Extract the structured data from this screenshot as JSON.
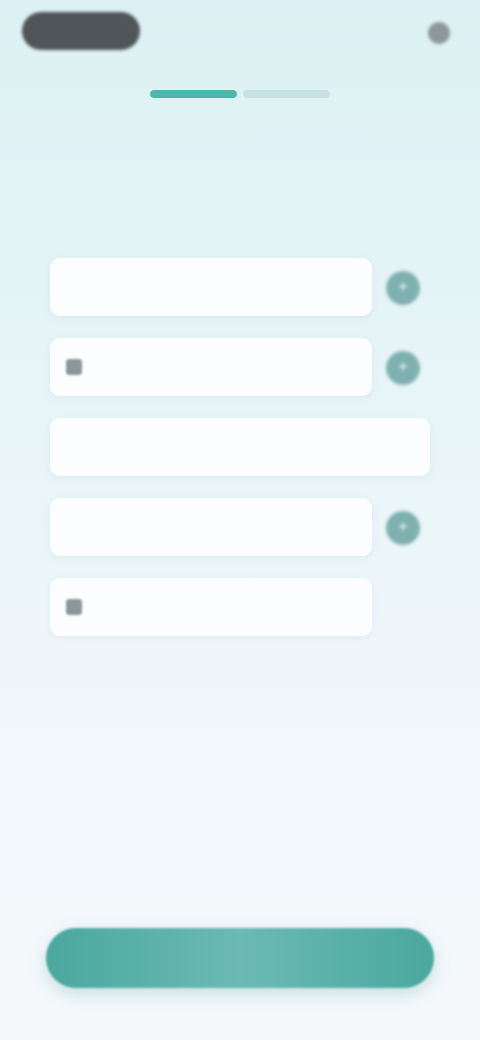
{
  "header": {
    "back_label": "",
    "right_label": ""
  },
  "progress": {
    "current_step": 1,
    "total_steps": 2
  },
  "page": {
    "title": "",
    "subtitle": ""
  },
  "form": {
    "fields": [
      {
        "label": "",
        "icon": "none",
        "has_action": true,
        "action_icon": "add-icon"
      },
      {
        "label": "",
        "icon": "flag-icon",
        "has_action": true,
        "action_icon": "add-icon"
      },
      {
        "label": "",
        "icon": "none",
        "has_action": false
      },
      {
        "label": "",
        "icon": "none",
        "has_action": true,
        "action_icon": "add-icon"
      },
      {
        "label": "",
        "icon": "flag-icon",
        "has_action": false
      }
    ]
  },
  "footer": {
    "link_text": "",
    "cta_label": ""
  },
  "colors": {
    "accent": "#4fb6aa",
    "cta": "#4aa89f",
    "background_top": "#dcf1f3",
    "background_bottom": "#f4f8fb"
  }
}
